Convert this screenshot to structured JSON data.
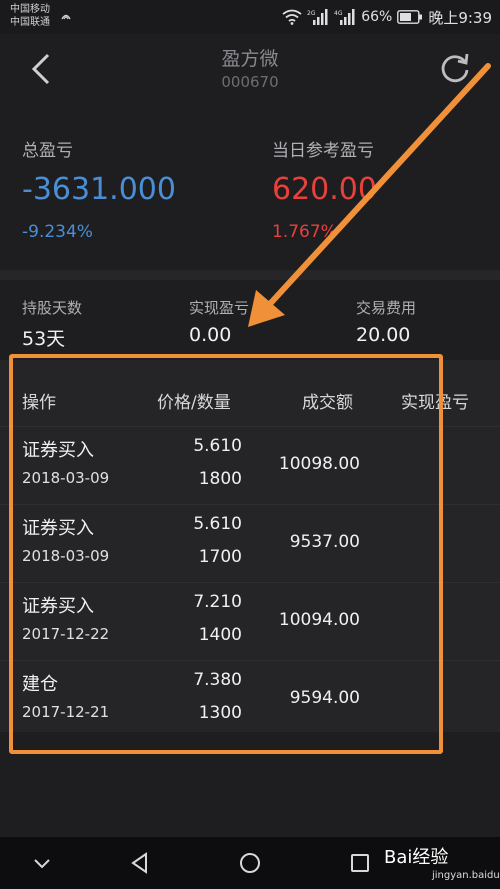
{
  "status_bar": {
    "carrier_1": "中国移动",
    "carrier_2": "中国联通",
    "signal_1_label": "2G",
    "signal_2_label": "4G",
    "battery": "66%",
    "time": "晚上9:39"
  },
  "header": {
    "title": "盈方微",
    "code": "000670"
  },
  "summary": {
    "total_label": "总盈亏",
    "total_value": "-3631.000",
    "total_pct": "-9.234%",
    "daily_label": "当日参考盈亏",
    "daily_value": "620.00",
    "daily_pct": "1.767%"
  },
  "stats": {
    "hold_days_label": "持股天数",
    "hold_days_value": "53天",
    "realized_label": "实现盈亏",
    "realized_value": "0.00",
    "fee_label": "交易费用",
    "fee_value": "20.00"
  },
  "table": {
    "columns": [
      "操作",
      "价格/数量",
      "成交额",
      "实现盈亏"
    ],
    "rows": [
      {
        "op": "证券买入",
        "date": "2018-03-09",
        "price": "5.610",
        "qty": "1800",
        "amount": "10098.00"
      },
      {
        "op": "证券买入",
        "date": "2018-03-09",
        "price": "5.610",
        "qty": "1700",
        "amount": "9537.00"
      },
      {
        "op": "证券买入",
        "date": "2017-12-22",
        "price": "7.210",
        "qty": "1400",
        "amount": "10094.00"
      },
      {
        "op": "建仓",
        "date": "2017-12-21",
        "price": "7.380",
        "qty": "1300",
        "amount": "9594.00"
      }
    ]
  },
  "watermark": {
    "brand": "Bai经验",
    "url": "jingyan.baidu.com"
  },
  "colors": {
    "negative": "#4a8fd6",
    "positive": "#e8413c",
    "annotation": "#f0913a"
  }
}
